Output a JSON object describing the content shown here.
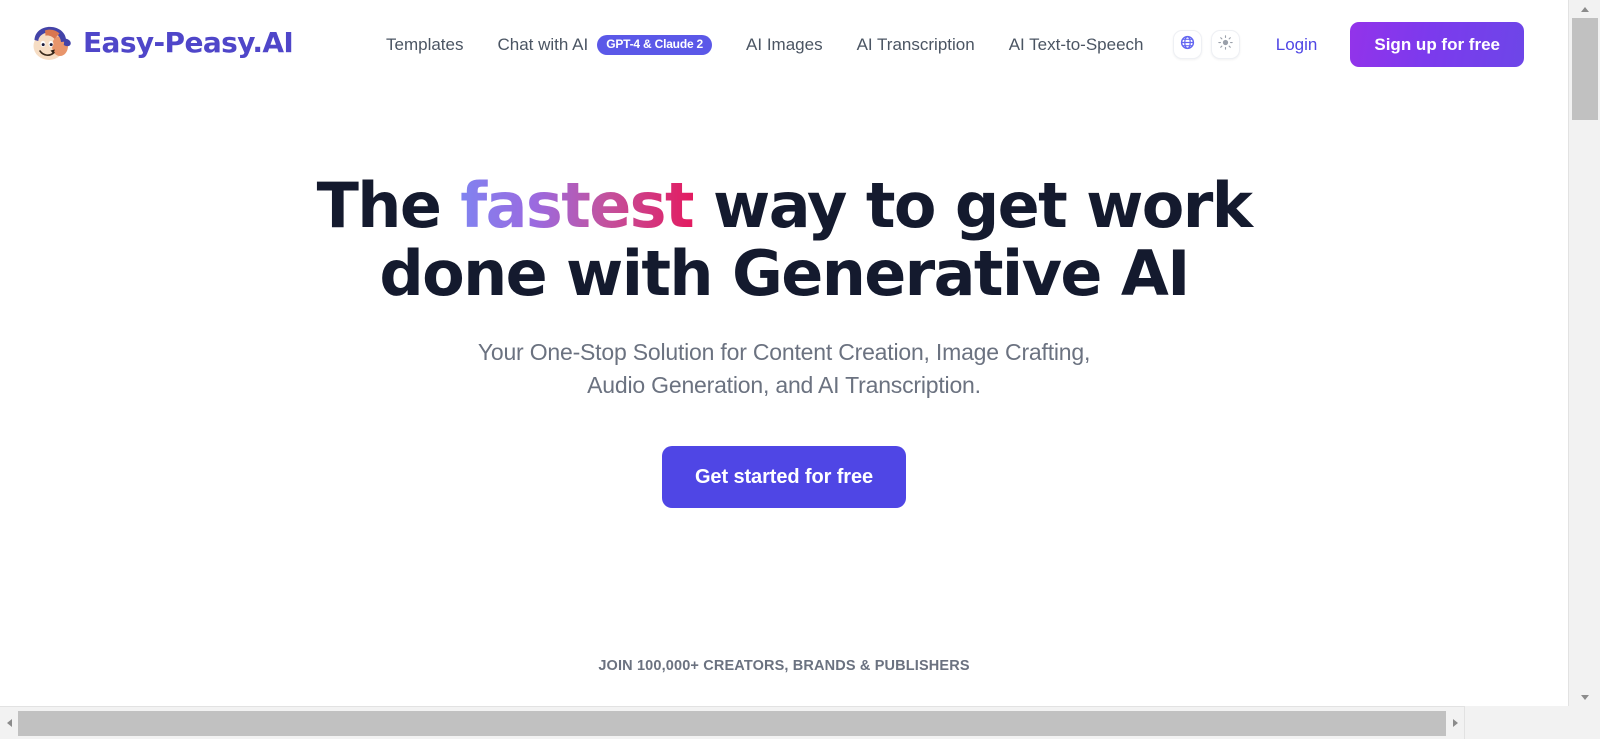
{
  "brand": {
    "name": "Easy-Peasy.AI",
    "logo_icon": "cartoon-face-with-cap-icon",
    "color": "#4f46c9"
  },
  "nav": {
    "items": [
      {
        "label": "Templates",
        "badge": null
      },
      {
        "label": "Chat with AI",
        "badge": "GPT-4 & Claude 2"
      },
      {
        "label": "AI Images",
        "badge": null
      },
      {
        "label": "AI Transcription",
        "badge": null
      },
      {
        "label": "AI Text-to-Speech",
        "badge": null
      }
    ]
  },
  "header_actions": {
    "language_icon": "globe-icon",
    "theme_icon": "sun-icon",
    "login_label": "Login",
    "signup_label": "Sign up for free",
    "signup_gradient_from": "#9333ea",
    "signup_gradient_to": "#6d46e8",
    "login_color": "#4f46e5"
  },
  "hero": {
    "title_part1": "The ",
    "title_highlight": "fastest",
    "title_part2": " way to get work done with Generative AI",
    "highlight_gradient_from": "#8083f0",
    "highlight_gradient_to": "#e31b60",
    "subtitle": "Your One-Stop Solution for Content Creation, Image Crafting, Audio Generation, and AI Transcription.",
    "cta_label": "Get started for free",
    "cta_color": "#4f46e5",
    "social_proof": "JOIN 100,000+ CREATORS, BRANDS & PUBLISHERS"
  },
  "scrollbars": {
    "vertical_up_icon": "triangle-up-icon",
    "vertical_down_icon": "triangle-down-icon",
    "horizontal_left_icon": "triangle-left-icon",
    "horizontal_right_icon": "triangle-right-icon"
  }
}
